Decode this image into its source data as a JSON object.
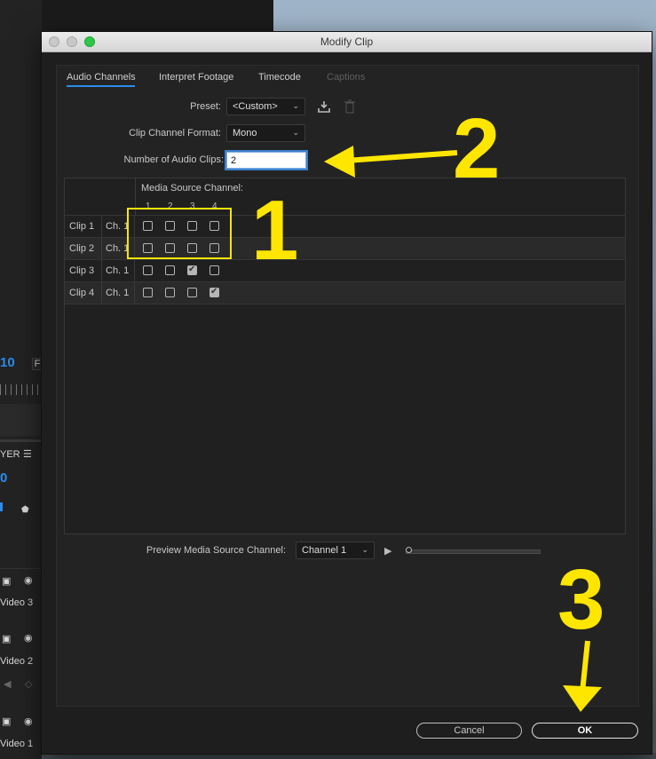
{
  "dialog": {
    "title": "Modify Clip",
    "tabs": [
      {
        "label": "Audio Channels",
        "active": true
      },
      {
        "label": "Interpret Footage",
        "active": false
      },
      {
        "label": "Timecode",
        "active": false
      },
      {
        "label": "Captions",
        "active": false,
        "disabled": true
      }
    ],
    "preset_label": "Preset:",
    "preset_value": "<Custom>",
    "channel_format_label": "Clip Channel Format:",
    "channel_format_value": "Mono",
    "num_clips_label": "Number of Audio Clips:",
    "num_clips_value": "2",
    "media_source_header": "Media Source Channel:",
    "channel_numbers": [
      "1",
      "2",
      "3",
      "4"
    ],
    "clips": [
      {
        "clip": "Clip 1",
        "channel": "Ch. 1",
        "checks": [
          false,
          false,
          false,
          false
        ]
      },
      {
        "clip": "Clip 2",
        "channel": "Ch. 1",
        "checks": [
          false,
          false,
          false,
          false
        ]
      },
      {
        "clip": "Clip 3",
        "channel": "Ch. 1",
        "checks": [
          false,
          false,
          true,
          false
        ]
      },
      {
        "clip": "Clip 4",
        "channel": "Ch. 1",
        "checks": [
          false,
          false,
          false,
          true
        ]
      }
    ],
    "preview_label": "Preview Media Source Channel:",
    "preview_value": "Channel 1",
    "cancel_label": "Cancel",
    "ok_label": "OK"
  },
  "annotations": {
    "one": "1",
    "two": "2",
    "three": "3",
    "color": "#ffe600"
  },
  "background": {
    "timecode_fragment": "10",
    "f_fragment": "F",
    "layer_fragment": "YER",
    "zero_fragment": "0",
    "tracks": [
      "Video 3",
      "Video 2",
      "Video 1"
    ]
  },
  "colors": {
    "accent": "#2d8ceb",
    "dialog_bg": "#1e1e1e"
  }
}
